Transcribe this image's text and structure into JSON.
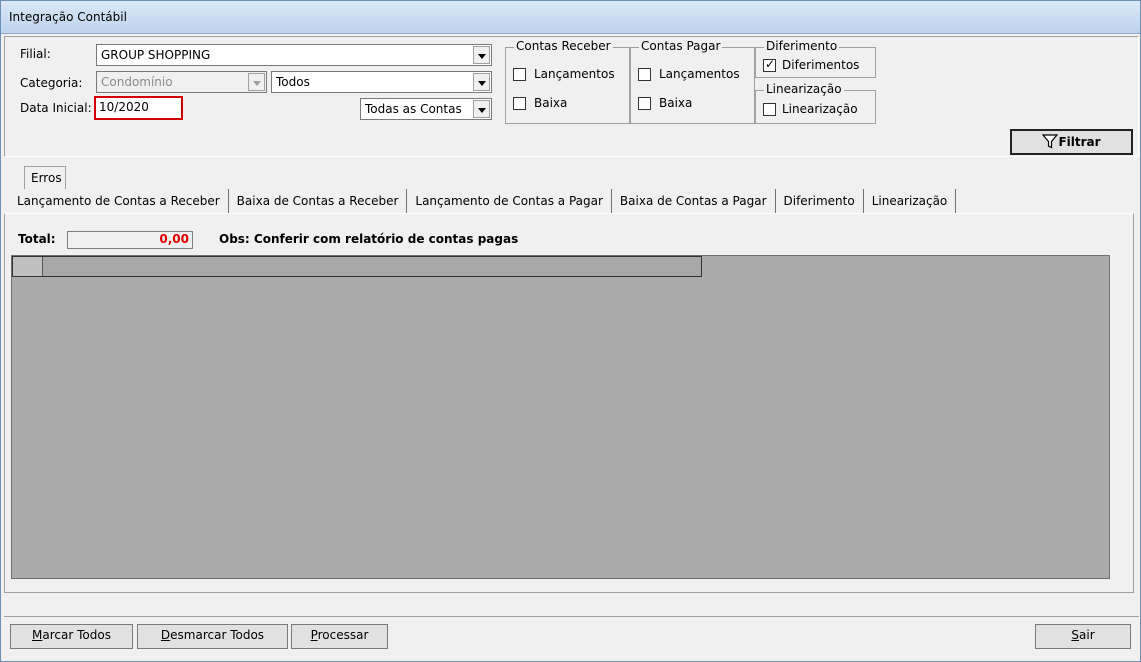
{
  "window": {
    "title": "Integração Contábil"
  },
  "filters": {
    "filial_label": "Filial:",
    "filial_value": "GROUP SHOPPING",
    "categoria_label": "Categoria:",
    "categoria_value": "Condomínio",
    "categoria_sub_value": "Todos",
    "data_label": "Data Inicial:",
    "data_value": "10/2020",
    "contas_value": "Todas as Contas"
  },
  "contas_receber": {
    "title": "Contas Receber",
    "lancamentos": "Lançamentos",
    "baixa": "Baixa"
  },
  "contas_pagar": {
    "title": "Contas Pagar",
    "lancamentos": "Lançamentos",
    "baixa": "Baixa"
  },
  "diferimento": {
    "title": "Diferimento",
    "option": "Diferimentos",
    "checked": true
  },
  "linearizacao": {
    "title": "Linearização",
    "option": "Linearização",
    "checked": false
  },
  "filtrar_button": "Filtrar",
  "tabs": {
    "erros": "Erros",
    "items": [
      "Lançamento de Contas a Receber",
      "Baixa de Contas a Receber",
      "Lançamento de Contas a Pagar",
      "Baixa de Contas a Pagar",
      "Diferimento",
      "Linearização"
    ],
    "active": "Baixa de Contas a Pagar"
  },
  "summary": {
    "total_label": "Total:",
    "total_value": "0,00",
    "obs": "Obs: Conferir com relatório de contas pagas"
  },
  "footer": {
    "marcar": {
      "u": "M",
      "rest": "arcar Todos"
    },
    "desmarcar": {
      "u": "D",
      "rest": "esmarcar Todos"
    },
    "processar": {
      "u": "P",
      "rest": "rocessar"
    },
    "sair": {
      "u": "S",
      "rest": "air"
    }
  }
}
